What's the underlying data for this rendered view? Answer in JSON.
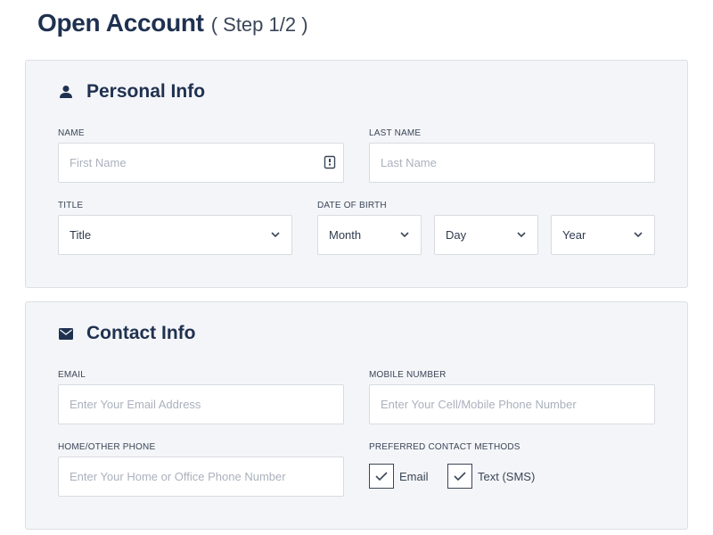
{
  "header": {
    "title": "Open Account",
    "step": "( Step 1/2 )"
  },
  "personal": {
    "heading": "Personal Info",
    "icon": "person-icon",
    "name_label": "NAME",
    "first_name_placeholder": "First Name",
    "contact_card_icon": "contact-card-icon",
    "last_name_label": "LAST NAME",
    "last_name_placeholder": "Last Name",
    "title_label": "TITLE",
    "title_value": "Title",
    "dob_label": "DATE OF BIRTH",
    "month_value": "Month",
    "day_value": "Day",
    "year_value": "Year"
  },
  "contact": {
    "heading": "Contact Info",
    "icon": "envelope-icon",
    "email_label": "EMAIL",
    "email_placeholder": "Enter Your Email Address",
    "mobile_label": "MOBILE NUMBER",
    "mobile_placeholder": "Enter Your Cell/Mobile Phone Number",
    "home_label": "HOME/OTHER PHONE",
    "home_placeholder": "Enter Your Home or Office Phone Number",
    "methods_label": "PREFERRED CONTACT METHODS",
    "method_email": "Email",
    "method_email_checked": true,
    "method_sms": "Text (SMS)",
    "method_sms_checked": true
  },
  "colors": {
    "heading": "#1f3150",
    "panel_bg": "#f4f5f8",
    "border": "#d8dbe1",
    "placeholder": "#aab1bc"
  }
}
